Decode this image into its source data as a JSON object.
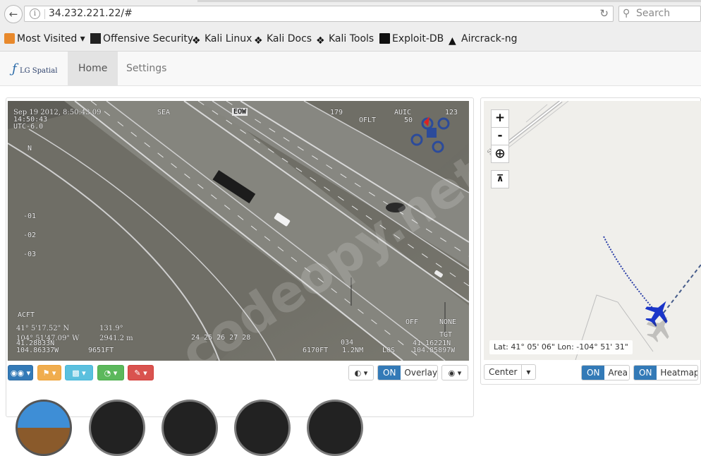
{
  "browser": {
    "url": "34.232.221.22/#",
    "search_placeholder": "Search",
    "bookmarks": [
      "Most Visited ▾",
      "Offensive Security",
      "Kali Linux",
      "Kali Docs",
      "Kali Tools",
      "Exploit-DB",
      "Aircrack-ng"
    ]
  },
  "app": {
    "logo_text": "LG Spatial",
    "tabs": [
      "Home",
      "Settings"
    ],
    "active_tab": "Home"
  },
  "video": {
    "overlay": {
      "datetime": "Sep 19 2012, 8:50:43.09",
      "time_local": "14:50:43",
      "utc": "UTC-6.0",
      "sea": "SEA",
      "eow": "EOW",
      "heading": "179",
      "oflt": "OFLT",
      "auto": "AUIC",
      "num_123": "123",
      "num_50": "50",
      "north": "N",
      "tick_01": "-01",
      "tick_02": "-02",
      "tick_03": "-03",
      "acft": "ACFT",
      "lat": "41° 5'17.52\" N",
      "lon": "104° 51'47.09\" W",
      "pos_a": "41.28833N",
      "pos_b": "104.86337W",
      "deg": "131.9°",
      "range": "2941.2 m",
      "alt_small": "9651FT",
      "scale": "24  25  26  27  28",
      "alt": "6170FT",
      "num_034": "034",
      "dist": "1.2NM",
      "los": "LOS",
      "los_b": "104.85897W",
      "los_a": "41.16221N",
      "tgt": "TGT",
      "off": "OFF",
      "none": "NONE"
    },
    "toolbar": {
      "overlay_state": "ON",
      "overlay_label": "Overlay"
    },
    "watermark": "codeopy.net"
  },
  "map": {
    "coords": "Lat: 41° 05' 06\" Lon: -104° 51' 31\"",
    "street_label": "St...on",
    "center_label": "Center",
    "area_state": "ON",
    "area_label": "Area",
    "heatmap_state": "ON",
    "heatmap_label": "Heatmap"
  }
}
